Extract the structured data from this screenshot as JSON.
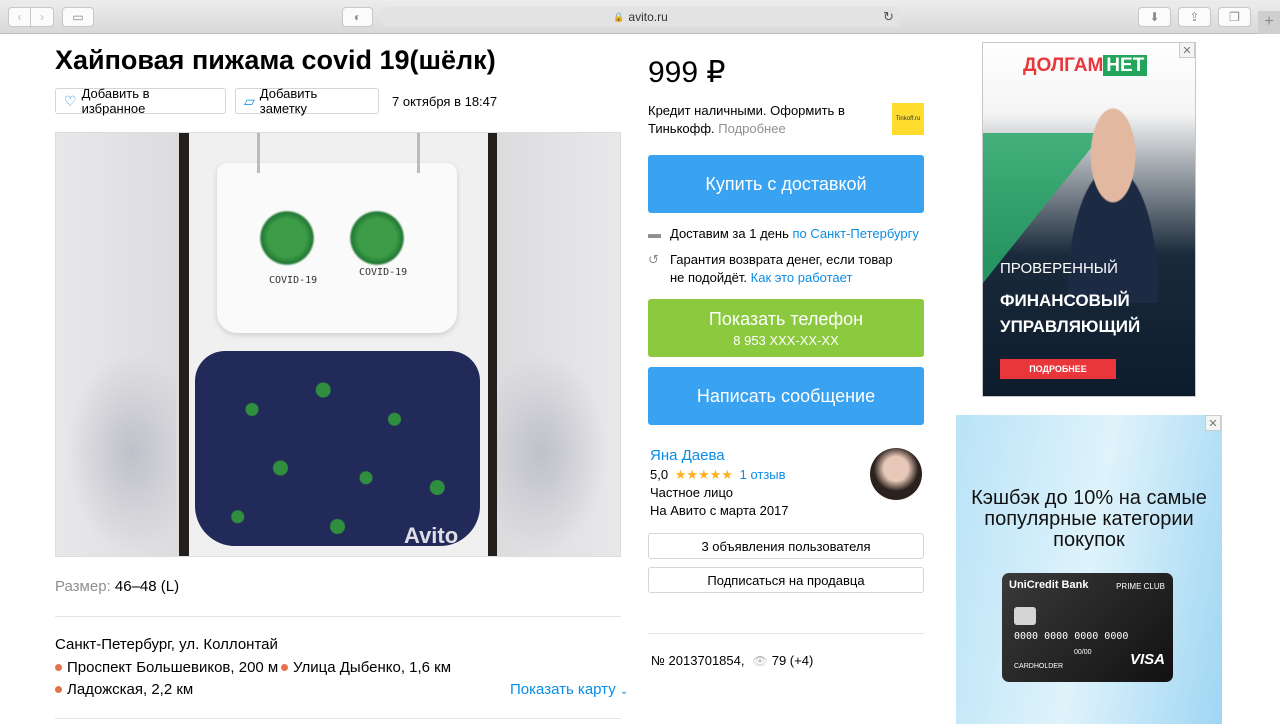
{
  "browser": {
    "url": "avito.ru"
  },
  "listing": {
    "title": "Хайповая пижама covid 19(шёлк)",
    "fav_label": "Добавить в избранное",
    "note_label": "Добавить заметку",
    "date": "7 октября в 18:47",
    "photo_watermark": "Avito",
    "photo_text_left": "COVID-19",
    "photo_text_right": "COVID-19",
    "size_label": "Размер:",
    "size_value": "46–48 (L)",
    "address": "Санкт-Петербург, ул. Коллонтай",
    "metro": [
      {
        "name": "Проспект Большевиков, 200 м"
      },
      {
        "name": "Улица Дыбенко, 1,6 км"
      },
      {
        "name": "Ладожская, 2,2 км"
      }
    ],
    "show_map": "Показать карту"
  },
  "sidebar": {
    "price": "999 ₽",
    "credit_text": "Кредит наличными. Оформить в Тинькофф.",
    "credit_more": "Подробнее",
    "tinkoff_logo": "Tinkoff.ru",
    "buy_label": "Купить с доставкой",
    "delivery_text": "Доставим за 1 день",
    "delivery_link": "по Санкт-Петербургу",
    "guarantee_text": "Гарантия возврата денег, если товар не подойдёт.",
    "guarantee_link": "Как это работает",
    "phone_label": "Показать телефон",
    "phone_number": "8 953 XXX-XX-XX",
    "message_label": "Написать сообщение",
    "seller": {
      "name": "Яна Даева",
      "rating": "5,0",
      "stars": "★★★★★",
      "reviews": "1 отзыв",
      "type": "Частное лицо",
      "since": "На Авито с марта 2017"
    },
    "user_ads_label": "3 объявления пользователя",
    "subscribe_label": "Подписаться на продавца",
    "ad_number": "№ 2013701854,",
    "views": "79 (+4)"
  },
  "ads": {
    "ad1": {
      "brand_left": "ДОЛГАМ",
      "brand_right": "НЕТ",
      "line1": "ПРОВЕРЕННЫЙ",
      "line2": "ФИНАНСОВЫЙ УПРАВЛЯЮЩИЙ",
      "cta": "ПОДРОБНЕЕ"
    },
    "ad2": {
      "headline": "Кэшбэк до 10% на самые популярные категории покупок",
      "bank": "UniCredit Bank",
      "club": "PRIME CLUB",
      "card_number": "0000 0000 0000 0000",
      "expiry": "00/00",
      "holder": "CARDHOLDER",
      "network": "VISA"
    }
  },
  "colors": {
    "link": "#0a8de6",
    "buy_button": "#39a2f1",
    "phone_button": "#8bc93e",
    "metro_dot": "#e4734c",
    "stars": "#ffb021"
  }
}
